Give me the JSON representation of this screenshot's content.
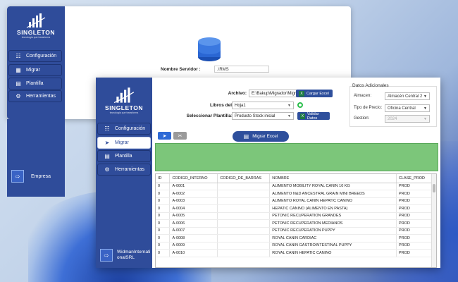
{
  "brand": {
    "name": "SINGLETON",
    "tagline": "tecnologia que transforma"
  },
  "back_window": {
    "nav": [
      {
        "label": "Configuración",
        "icon": "database-icon"
      },
      {
        "label": "Migrar",
        "icon": "table-icon"
      },
      {
        "label": "Plantilla",
        "icon": "document-icon"
      },
      {
        "label": "Herramientas",
        "icon": "gear-icon"
      }
    ],
    "server_label": "Nombre Servidor :",
    "server_value": ".\\RMS",
    "company_label": "Empresa"
  },
  "front_window": {
    "nav": [
      {
        "label": "Configuración",
        "icon": "database-icon"
      },
      {
        "label": "Migrar",
        "icon": "send-icon"
      },
      {
        "label": "Plantilla",
        "icon": "document-icon"
      },
      {
        "label": "Herramientas",
        "icon": "gear-icon"
      }
    ],
    "company_label": "WidmanInternationalSRL",
    "archivo_label": "Archivo:",
    "archivo_value": "E:\\Bakup\\Migrador\\Migracio",
    "cargar_label": "Cargar Excel",
    "libros_label": "Libros del Excel:",
    "libros_value": "Hoja1",
    "plantilla_label": "Seleccionar Plantilla:",
    "plantilla_value": "Producto Stock inicial",
    "validar_label": "Validar Datos",
    "migrar_label": "Migrar Excel",
    "datos": {
      "title": "Datos Adicionales",
      "almacen_label": "Almacen:",
      "almacen_value": "Almacén Central 2",
      "tipo_label": "Tipo de Precio:",
      "tipo_value": "Oficina Central",
      "gestion_label": "Gestion:",
      "gestion_value": "2024"
    },
    "table": {
      "headers": [
        "ID",
        "CODIGO_INTERNO",
        "CODIGO_DE_BARRAS",
        "NOMBRE",
        "CLASE_PROD"
      ],
      "rows": [
        [
          "0",
          "A-0001",
          "",
          "ALIMENTO MOBILITY ROYAL CANIN 10 KG",
          "PROD"
        ],
        [
          "0",
          "A-0002",
          "",
          "ALIMENTO N&D ANCESTRAL GRAIN MINI BREEDS",
          "PROD"
        ],
        [
          "0",
          "A-0003",
          "",
          "ALIMENTO ROYAL CANIN HEPATIC CANINO",
          "PROD"
        ],
        [
          "0",
          "A-0004",
          "",
          "HEPATIC CANINO (ALIMENTO EN PASTA)",
          "PROD"
        ],
        [
          "0",
          "A-0005",
          "",
          "PETONIC RECUPERATION GRANDES",
          "PROD"
        ],
        [
          "0",
          "A-0006",
          "",
          "PETONIC RECUPERATION MEDIANOS",
          "PROD"
        ],
        [
          "0",
          "A-0007",
          "",
          "PETONIC RECUPERATION PUPPY",
          "PROD"
        ],
        [
          "0",
          "A-0008",
          "",
          "ROYAL CANIN CARDIAC",
          "PROD"
        ],
        [
          "0",
          "A-0009",
          "",
          "ROYAL CANIN GASTROINTESTINAL PUPPY",
          "PROD"
        ],
        [
          "0",
          "A-0010",
          "",
          "ROYAL CANIN HEPATIC CANINO",
          "PROD"
        ]
      ]
    }
  },
  "colors": {
    "sidebar": "#2f4c9a",
    "accent": "#2e4f9c",
    "panel_green": "#7cc67a"
  }
}
